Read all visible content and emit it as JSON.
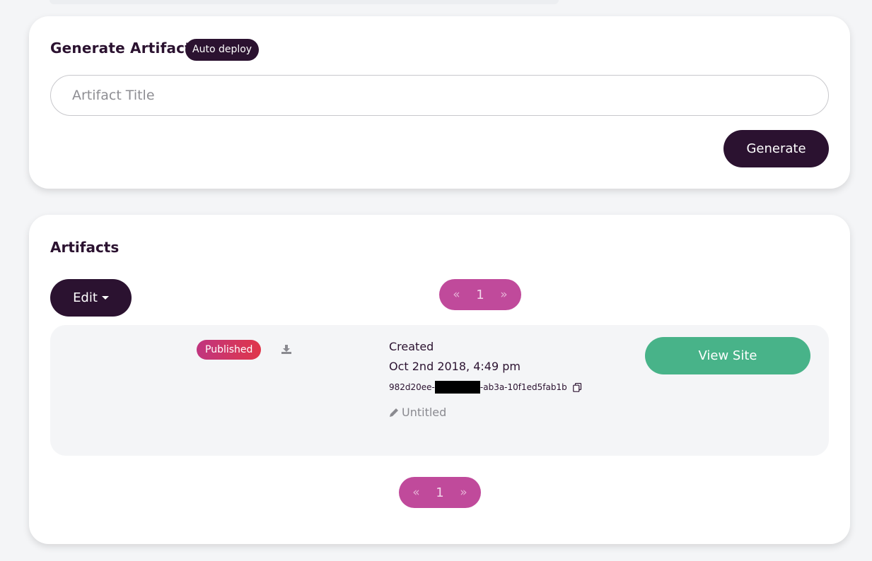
{
  "generate": {
    "title": "Generate Artifact",
    "badge": "Auto deploy",
    "input_placeholder": "Artifact Title",
    "input_value": "",
    "button_label": "Generate"
  },
  "artifacts": {
    "title": "Artifacts",
    "edit_label": "Edit",
    "pager_top": {
      "prev": "«",
      "page": "1",
      "next": "»"
    },
    "pager_bottom": {
      "prev": "«",
      "page": "1",
      "next": "»"
    },
    "items": [
      {
        "status": "Published",
        "created_label": "Created",
        "created_date": "Oct 2nd 2018, 4:49 pm",
        "uuid_start": "982d20ee-",
        "uuid_end": "-ab3a-10f1ed5fab1b",
        "name": "Untitled",
        "view_label": "View Site"
      }
    ]
  },
  "colors": {
    "primary": "#2b1230",
    "pager": "#c04a9b",
    "published_start": "#c0357f",
    "published_end": "#e0364a",
    "view_site": "#48b389"
  },
  "icons": [
    "download-icon",
    "copy-icon",
    "pencil-icon",
    "caret-down-icon"
  ]
}
